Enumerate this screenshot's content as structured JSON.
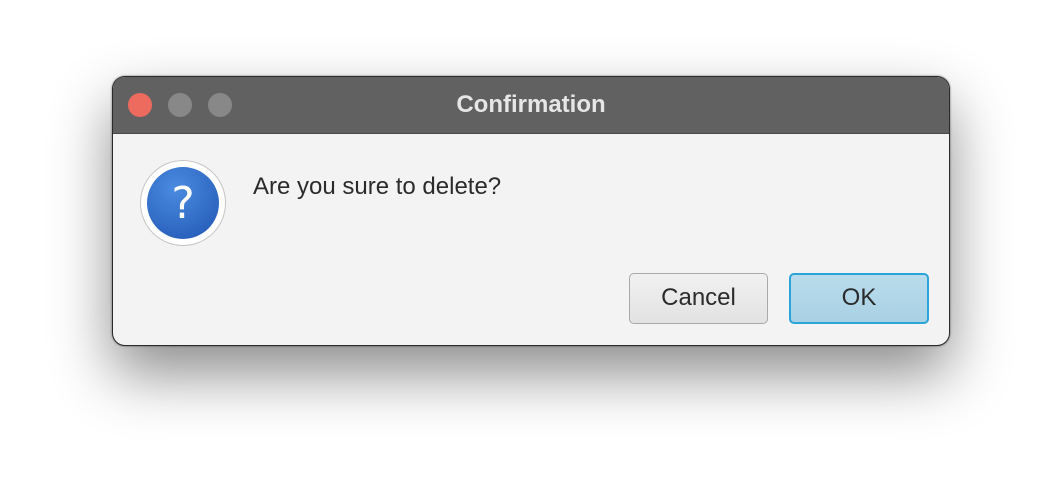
{
  "dialog": {
    "title": "Confirmation",
    "message": "Are you sure to delete?",
    "icon": "question-icon",
    "traffic_lights": {
      "close_color": "#ec6a5e",
      "minimize_color": "#888888",
      "maximize_color": "#888888"
    },
    "buttons": {
      "cancel_label": "Cancel",
      "ok_label": "OK"
    },
    "colors": {
      "titlebar": "#616161",
      "body": "#f3f3f3",
      "icon_blue": "#3372c9",
      "default_button_border": "#2aa4d9"
    }
  }
}
